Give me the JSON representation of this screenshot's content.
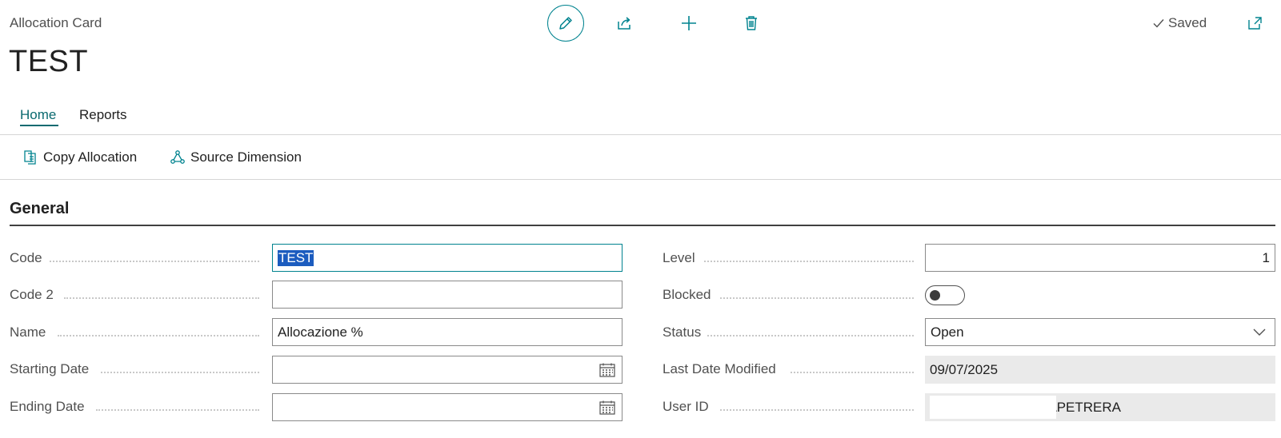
{
  "header": {
    "caption": "Allocation Card",
    "title": "TEST",
    "status": "Saved"
  },
  "toolbar": {
    "icons": [
      "edit-icon",
      "share-icon",
      "plus-icon",
      "trash-icon",
      "popout-icon"
    ]
  },
  "tabs": [
    {
      "label": "Home",
      "active": true
    },
    {
      "label": "Reports",
      "active": false
    }
  ],
  "actions": [
    {
      "label": "Copy Allocation",
      "icon": "copy-icon"
    },
    {
      "label": "Source Dimension",
      "icon": "dimension-icon"
    }
  ],
  "general": {
    "title": "General",
    "left": [
      {
        "label": "Code",
        "value": "TEST"
      },
      {
        "label": "Code 2",
        "value": ""
      },
      {
        "label": "Name",
        "value": "Allocazione %"
      },
      {
        "label": "Starting Date",
        "value": ""
      },
      {
        "label": "Ending Date",
        "value": ""
      }
    ],
    "right": [
      {
        "label": "Level",
        "value": "1"
      },
      {
        "label": "Blocked",
        "value": "off"
      },
      {
        "label": "Status",
        "value": "Open"
      },
      {
        "label": "Last Date Modified",
        "value": "09/07/2025"
      },
      {
        "label": "User ID",
        "value": "\\PETRERA"
      }
    ]
  },
  "colors": {
    "accent": "#00838f",
    "tab_active": "#0b6a70",
    "selection": "#1c5cbf",
    "readonly_bg": "#eaeaea"
  }
}
